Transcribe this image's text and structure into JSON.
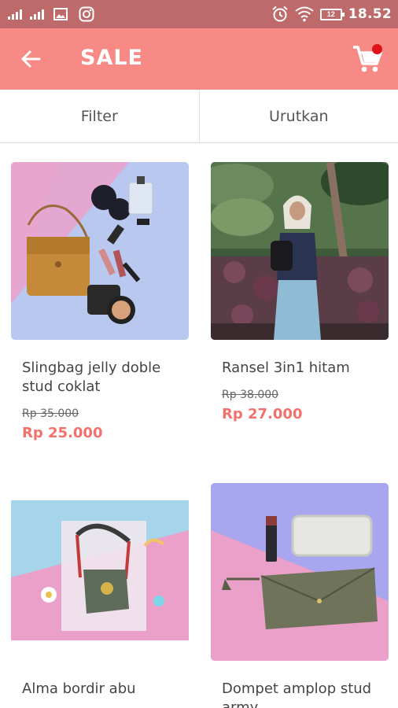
{
  "status_bar": {
    "time": "18.52",
    "battery": "12",
    "signal_label_1": "ıl",
    "signal_label_2": "ıl",
    "icons": [
      "signal-icon",
      "signal-icon",
      "image-icon",
      "instagram-icon",
      "alarm-icon",
      "wifi-icon",
      "battery-icon"
    ]
  },
  "app_bar": {
    "title": "SALE",
    "back_icon": "arrow-left-icon",
    "cart_icon": "cart-icon",
    "has_notification": true
  },
  "toolbar": {
    "filter_label": "Filter",
    "sort_label": "Urutkan"
  },
  "products": [
    {
      "name": "Slingbag jelly doble stud coklat",
      "old_price": "Rp 35.000",
      "new_price": "Rp 25.000"
    },
    {
      "name": "Ransel 3in1 hitam",
      "old_price": "Rp 38.000",
      "new_price": "Rp 27.000"
    },
    {
      "name": "Alma bordir abu",
      "old_price": "",
      "new_price": ""
    },
    {
      "name": "Dompet amplop stud army",
      "old_price": "",
      "new_price": ""
    }
  ],
  "colors": {
    "status_bar": "#bf6a6a",
    "app_bar": "#f88a86",
    "price_accent": "#f3716c",
    "notification_dot": "#e0131a"
  }
}
